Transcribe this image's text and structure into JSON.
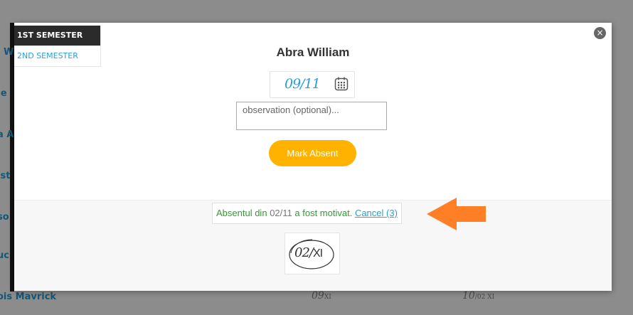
{
  "background": {
    "rows": [
      {
        "name": "i W"
      },
      {
        "name": "Je"
      },
      {
        "name": "a A"
      },
      {
        "name": "ist"
      },
      {
        "name": "so"
      },
      {
        "name": "uc"
      },
      {
        "name": "ois Mavrick"
      }
    ],
    "bottom_cells": [
      {
        "day": "09",
        "month": "XI"
      },
      {
        "day": "10",
        "sep": "/",
        "month": "02 XI"
      }
    ]
  },
  "semesters": {
    "first": "1ST SEMESTER",
    "second": "2ND SEMESTER"
  },
  "modal": {
    "close_icon": "×",
    "student_name": "Abra William",
    "date": "09/11",
    "calendar_icon": "calendar-icon",
    "observation_placeholder": "observation (optional)...",
    "mark_button": "Mark Absent"
  },
  "notice": {
    "prefix": "Absentul din",
    "date": "02/11",
    "middle": "a fost motivat.",
    "cancel": "Cancel (3)"
  },
  "stamp": {
    "day": "02/",
    "month": "XI"
  },
  "colors": {
    "accent": "#2a9fd6",
    "button": "#ffb300",
    "success": "#2e9e2e",
    "arrow": "#ff7f27"
  }
}
